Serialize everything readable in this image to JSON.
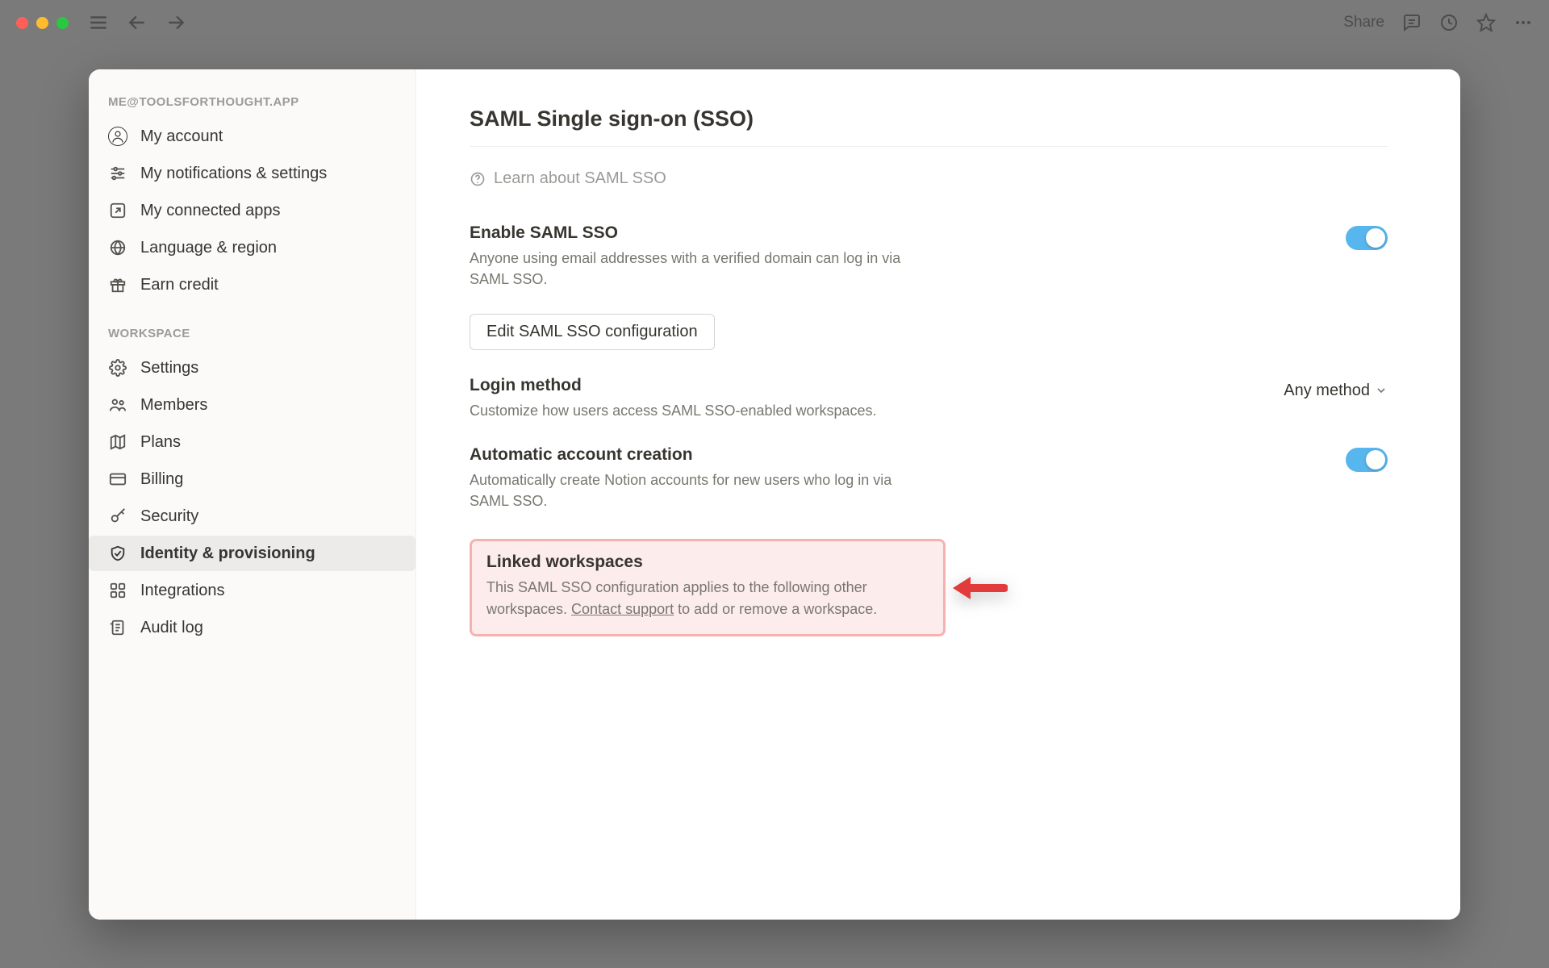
{
  "titlebar": {
    "share": "Share"
  },
  "sidebar": {
    "account_header": "ME@TOOLSFORTHOUGHT.APP",
    "workspace_header": "WORKSPACE",
    "account_items": [
      {
        "label": "My account"
      },
      {
        "label": "My notifications & settings"
      },
      {
        "label": "My connected apps"
      },
      {
        "label": "Language & region"
      },
      {
        "label": "Earn credit"
      }
    ],
    "workspace_items": [
      {
        "label": "Settings"
      },
      {
        "label": "Members"
      },
      {
        "label": "Plans"
      },
      {
        "label": "Billing"
      },
      {
        "label": "Security"
      },
      {
        "label": "Identity & provisioning"
      },
      {
        "label": "Integrations"
      },
      {
        "label": "Audit log"
      }
    ]
  },
  "content": {
    "title": "SAML Single sign-on (SSO)",
    "help_link": "Learn about SAML SSO",
    "enable": {
      "title": "Enable SAML SSO",
      "desc": "Anyone using email addresses with a verified domain can log in via SAML SSO."
    },
    "edit_btn": "Edit SAML SSO configuration",
    "login": {
      "title": "Login method",
      "desc": "Customize how users access SAML SSO-enabled workspaces.",
      "value": "Any method"
    },
    "auto": {
      "title": "Automatic account creation",
      "desc": "Automatically create Notion accounts for new users who log in via SAML SSO."
    },
    "linked": {
      "title": "Linked workspaces",
      "desc_a": "This SAML SSO configuration applies to the following other workspaces. ",
      "link": "Contact support",
      "desc_b": " to add or remove a workspace."
    }
  }
}
